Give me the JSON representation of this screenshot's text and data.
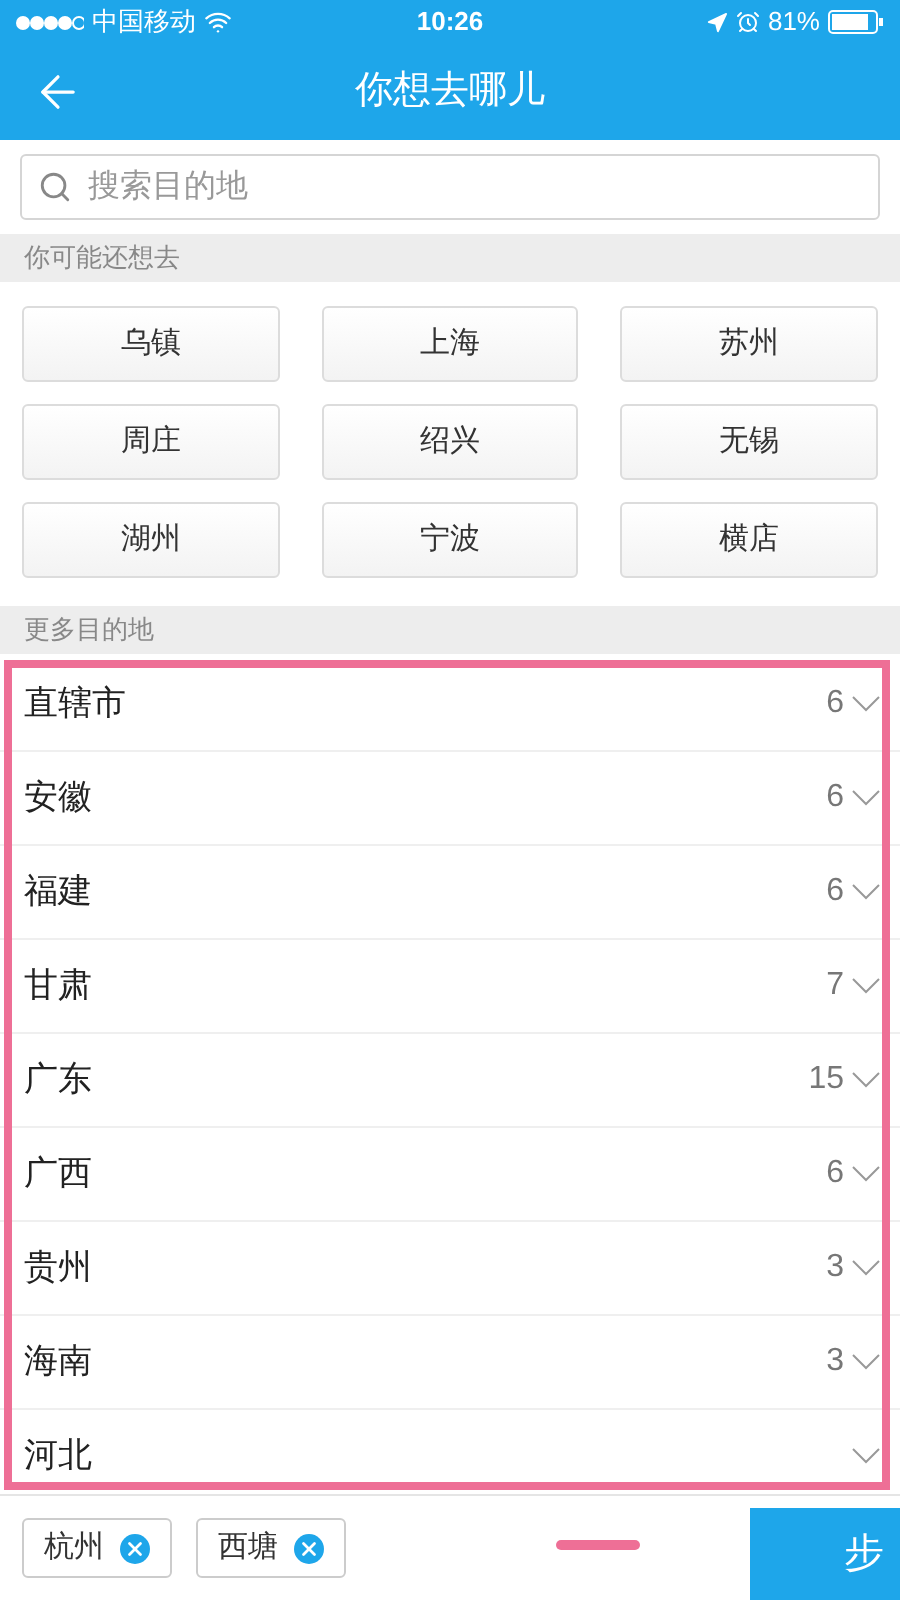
{
  "status_bar": {
    "carrier": "中国移动",
    "time": "10:26",
    "battery": "81%"
  },
  "nav": {
    "title": "你想去哪儿"
  },
  "search": {
    "placeholder": "搜索目的地"
  },
  "suggested": {
    "heading": "你可能还想去",
    "items": [
      "乌镇",
      "上海",
      "苏州",
      "周庄",
      "绍兴",
      "无锡",
      "湖州",
      "宁波",
      "横店"
    ]
  },
  "more": {
    "heading": "更多目的地",
    "items": [
      {
        "name": "直辖市",
        "count": "6"
      },
      {
        "name": "安徽",
        "count": "6"
      },
      {
        "name": "福建",
        "count": "6"
      },
      {
        "name": "甘肃",
        "count": "7"
      },
      {
        "name": "广东",
        "count": "15"
      },
      {
        "name": "广西",
        "count": "6"
      },
      {
        "name": "贵州",
        "count": "3"
      },
      {
        "name": "海南",
        "count": "3"
      },
      {
        "name": "河北"
      }
    ]
  },
  "selected_tags": [
    "杭州",
    "西塘"
  ],
  "next_button": "步"
}
